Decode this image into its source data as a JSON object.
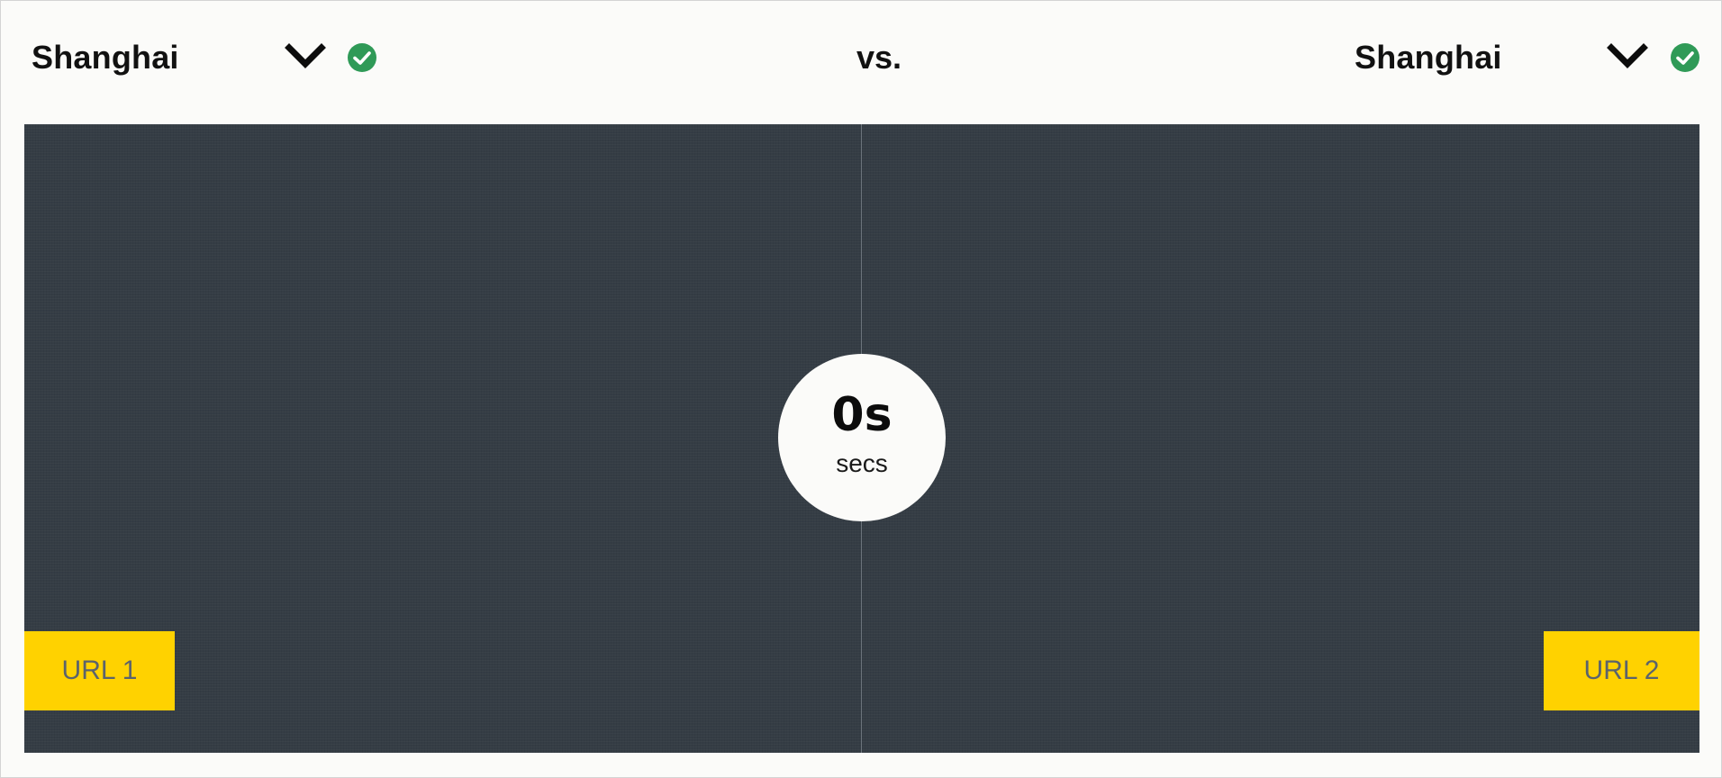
{
  "header": {
    "left_location": {
      "value": "Shanghai",
      "dropdown_icon": "chevron-down-icon",
      "status_icon": "check-circle-icon"
    },
    "vs_label": "vs.",
    "right_location": {
      "value": "Shanghai",
      "dropdown_icon": "chevron-down-icon",
      "status_icon": "check-circle-icon"
    }
  },
  "stage": {
    "timer": {
      "value": "0s",
      "unit": "secs"
    },
    "left_badge": "URL 1",
    "right_badge": "URL 2"
  },
  "colors": {
    "stage_background": "#353d45",
    "badge_yellow": "#ffd200",
    "check_green": "#2f9a57",
    "page_background": "#fbfbf9"
  }
}
